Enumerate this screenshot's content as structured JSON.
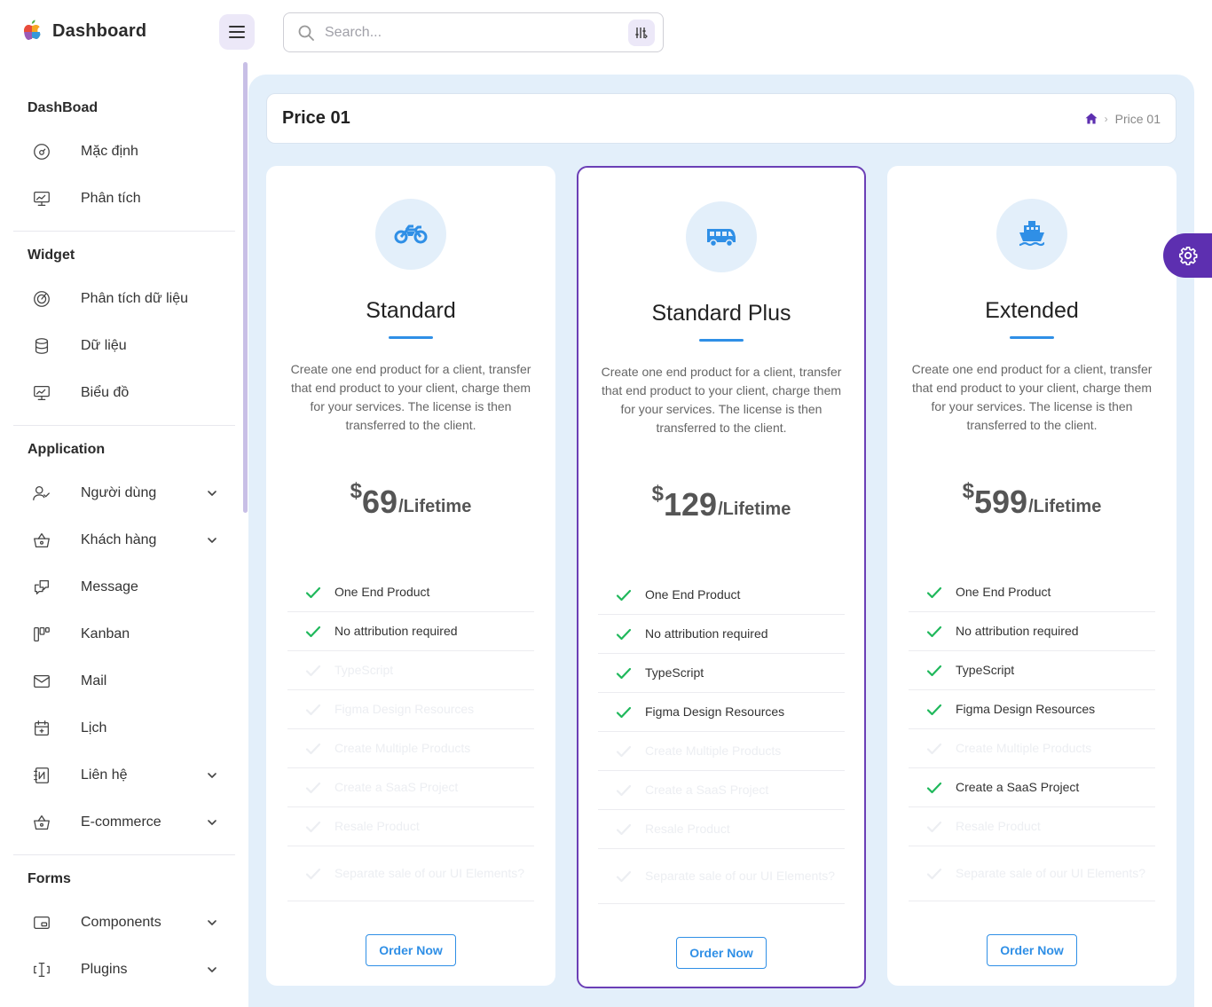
{
  "app": {
    "title": "Dashboard"
  },
  "search": {
    "placeholder": "Search..."
  },
  "sidebar": {
    "sections": [
      {
        "heading": "DashBoad",
        "items": [
          {
            "label": "Mặc định",
            "icon": "gauge-icon",
            "chevron": false
          },
          {
            "label": "Phân tích",
            "icon": "monitor-chart-icon",
            "chevron": false
          }
        ]
      },
      {
        "heading": "Widget",
        "items": [
          {
            "label": "Phân tích dữ liệu",
            "icon": "radar-icon",
            "chevron": false
          },
          {
            "label": "Dữ liệu",
            "icon": "database-icon",
            "chevron": false
          },
          {
            "label": "Biểu đồ",
            "icon": "monitor-chart-icon",
            "chevron": false
          }
        ]
      },
      {
        "heading": "Application",
        "items": [
          {
            "label": "Người dùng",
            "icon": "user-check-icon",
            "chevron": true
          },
          {
            "label": "Khách hàng",
            "icon": "basket-icon",
            "chevron": true
          },
          {
            "label": "Message",
            "icon": "messages-icon",
            "chevron": false
          },
          {
            "label": "Kanban",
            "icon": "kanban-icon",
            "chevron": false
          },
          {
            "label": "Mail",
            "icon": "mail-icon",
            "chevron": false
          },
          {
            "label": "Lịch",
            "icon": "calendar-icon",
            "chevron": false
          },
          {
            "label": "Liên hệ",
            "icon": "notebook-icon",
            "chevron": true
          },
          {
            "label": "E-commerce",
            "icon": "basket-icon",
            "chevron": true
          }
        ]
      },
      {
        "heading": "Forms",
        "items": [
          {
            "label": "Components",
            "icon": "components-icon",
            "chevron": true
          },
          {
            "label": "Plugins",
            "icon": "cursor-text-icon",
            "chevron": true
          }
        ]
      }
    ]
  },
  "page": {
    "title": "Price 01",
    "breadcrumb": [
      "Price 01"
    ]
  },
  "plans": [
    {
      "name": "Standard",
      "icon": "motorbike-icon",
      "description": "Create one end product for a client, transfer that end product to your client, charge them for your services. The license is then transferred to the client.",
      "currency": "$",
      "price": "69",
      "period": "/Lifetime",
      "features": [
        {
          "text": "One End Product",
          "included": true
        },
        {
          "text": "No attribution required",
          "included": true
        },
        {
          "text": "TypeScript",
          "included": false
        },
        {
          "text": "Figma Design Resources",
          "included": false
        },
        {
          "text": "Create Multiple Products",
          "included": false
        },
        {
          "text": "Create a SaaS Project",
          "included": false
        },
        {
          "text": "Resale Product",
          "included": false
        },
        {
          "text": "Separate sale of our UI Elements?",
          "included": false
        }
      ],
      "button": "Order Now",
      "featured": false
    },
    {
      "name": "Standard Plus",
      "icon": "van-icon",
      "description": "Create one end product for a client, transfer that end product to your client, charge them for your services. The license is then transferred to the client.",
      "currency": "$",
      "price": "129",
      "period": "/Lifetime",
      "features": [
        {
          "text": "One End Product",
          "included": true
        },
        {
          "text": "No attribution required",
          "included": true
        },
        {
          "text": "TypeScript",
          "included": true
        },
        {
          "text": "Figma Design Resources",
          "included": true
        },
        {
          "text": "Create Multiple Products",
          "included": false
        },
        {
          "text": "Create a SaaS Project",
          "included": false
        },
        {
          "text": "Resale Product",
          "included": false
        },
        {
          "text": "Separate sale of our UI Elements?",
          "included": false
        }
      ],
      "button": "Order Now",
      "featured": true
    },
    {
      "name": "Extended",
      "icon": "ship-icon",
      "description": "Create one end product for a client, transfer that end product to your client, charge them for your services. The license is then transferred to the client.",
      "currency": "$",
      "price": "599",
      "period": "/Lifetime",
      "features": [
        {
          "text": "One End Product",
          "included": true
        },
        {
          "text": "No attribution required",
          "included": true
        },
        {
          "text": "TypeScript",
          "included": true
        },
        {
          "text": "Figma Design Resources",
          "included": true
        },
        {
          "text": "Create Multiple Products",
          "included": false
        },
        {
          "text": "Create a SaaS Project",
          "included": true
        },
        {
          "text": "Resale Product",
          "included": false
        },
        {
          "text": "Separate sale of our UI Elements?",
          "included": false
        }
      ],
      "button": "Order Now",
      "featured": false
    }
  ],
  "colors": {
    "accent": "#2f8fe6",
    "brand": "#5d2fb0",
    "check": "#1fb85b",
    "background": "#e3effa"
  }
}
